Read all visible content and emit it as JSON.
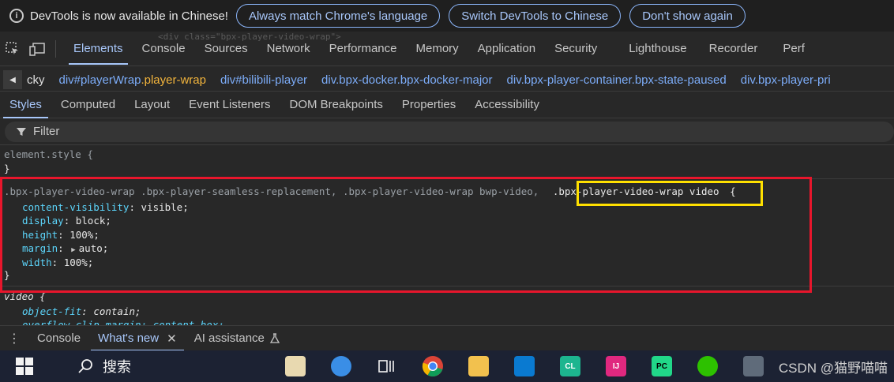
{
  "infobar": {
    "message": "DevTools is now available in Chinese!",
    "buttons": [
      "Always match Chrome's language",
      "Switch DevTools to Chinese",
      "Don't show again"
    ]
  },
  "main_tabs": [
    "Elements",
    "Console",
    "Sources",
    "Network",
    "Performance",
    "Memory",
    "Application",
    "Security",
    "Lighthouse",
    "Recorder",
    "Perf"
  ],
  "ghost_code": "<div class=\"bpx-player-video-wrap\">",
  "breadcrumb": [
    {
      "plain": "cky",
      "tag": "",
      "cls": ""
    },
    {
      "plain": "",
      "tag": "div#playerWrap",
      "cls": ".player-wrap"
    },
    {
      "plain": "",
      "tag": "div#bilibili-player",
      "cls": ""
    },
    {
      "plain": "",
      "tag": "div.bpx-docker.bpx-docker-major",
      "cls": ""
    },
    {
      "plain": "",
      "tag": "div.bpx-player-container.bpx-state-paused",
      "cls": ""
    },
    {
      "plain": "",
      "tag": "div.bpx-player-pri",
      "cls": ""
    }
  ],
  "sub_tabs": [
    "Styles",
    "Computed",
    "Layout",
    "Event Listeners",
    "DOM Breakpoints",
    "Properties",
    "Accessibility"
  ],
  "filter": {
    "placeholder": "Filter"
  },
  "styles": {
    "element_style_open": "element.style {",
    "element_style_close": "}",
    "rule1_selector_dim": ".bpx-player-video-wrap .bpx-player-seamless-replacement, .bpx-player-video-wrap bwp-video,",
    "rule1_selector_match": ".bpx-player-video-wrap video",
    "rule1_open": "{",
    "rule1_decls": [
      {
        "prop": "content-visibility",
        "val": "visible;"
      },
      {
        "prop": "display",
        "val": "block;"
      },
      {
        "prop": "height",
        "val": "100%;"
      },
      {
        "prop": "margin",
        "val": "auto;"
      },
      {
        "prop": "width",
        "val": "100%;"
      }
    ],
    "rule1_close": "}",
    "rule2_selector": "video {",
    "rule2_decl": {
      "prop": "object-fit",
      "val": "contain;"
    },
    "rule2_decl_cut": "overflow-clip-margin: content-box;"
  },
  "drawer": {
    "tabs": [
      "Console",
      "What's new",
      "AI assistance"
    ]
  },
  "taskbar": {
    "search_label": "搜索",
    "apps": [
      "notes-app",
      "qq-penguin",
      "task-view",
      "chrome",
      "file-explorer",
      "vscode",
      "clion",
      "intellij",
      "pycharm",
      "wechat",
      "calculator"
    ]
  },
  "watermark": "CSDN @猫野喵喵",
  "colors": {
    "accent": "#a8c7fa",
    "red_box": "#e8162c",
    "yellow_box": "#ffe000"
  }
}
